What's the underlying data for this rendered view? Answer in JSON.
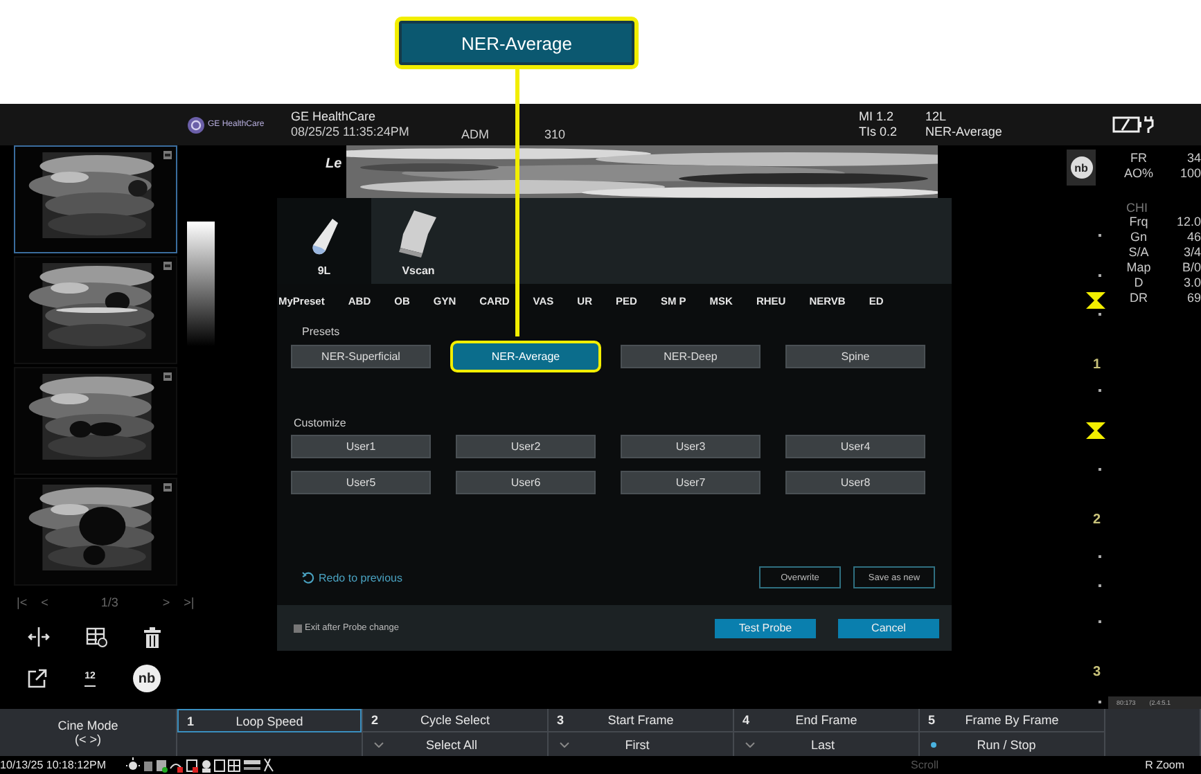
{
  "callout": {
    "label": "NER-Average"
  },
  "header": {
    "brand": "GE HealthCare",
    "title": "GE HealthCare",
    "datetime": "08/25/25 11:35:24PM",
    "operator": "ADM",
    "field_3": "310",
    "mi": "MI 1.2",
    "tis": "TIs 0.2",
    "probe": "12L",
    "preset": "NER-Average"
  },
  "thumbnails": [
    {
      "selected": true
    },
    {
      "selected": false
    },
    {
      "selected": false
    },
    {
      "selected": false
    }
  ],
  "pager": {
    "first": "|<",
    "prev": "<",
    "page": "1/3",
    "next": ">",
    "last": ">|"
  },
  "left_tools": {
    "count": "12",
    "nb": "nb"
  },
  "image": {
    "label": "Le"
  },
  "dialog": {
    "probes": [
      {
        "name": "9L",
        "selected": true
      },
      {
        "name": "Vscan",
        "selected": false
      }
    ],
    "categories": [
      "MyPreset",
      "ABD",
      "OB",
      "GYN",
      "CARD",
      "VAS",
      "UR",
      "PED",
      "SM P",
      "MSK",
      "RHEU",
      "NERVB",
      "ED"
    ],
    "presets_label": "Presets",
    "presets": [
      {
        "label": "NER-Superficial",
        "selected": false
      },
      {
        "label": "NER-Average",
        "selected": true
      },
      {
        "label": "NER-Deep",
        "selected": false
      },
      {
        "label": "Spine",
        "selected": false
      }
    ],
    "customize_label": "Customize",
    "user_presets": [
      "User1",
      "User2",
      "User3",
      "User4",
      "User5",
      "User6",
      "User7",
      "User8"
    ],
    "redo": "Redo to previous",
    "overwrite": "Overwrite",
    "save_as_new": "Save as new",
    "exit_after_probe_change": {
      "label": "Exit after Probe change",
      "checked": false
    },
    "test_probe": "Test Probe",
    "cancel": "Cancel"
  },
  "params": {
    "nb": "nb",
    "top": [
      {
        "name": "FR",
        "value": "34"
      },
      {
        "name": "AO%",
        "value": "100"
      }
    ],
    "mode": "CHI",
    "rows": [
      {
        "name": "Frq",
        "value": "12.0"
      },
      {
        "name": "Gn",
        "value": "46"
      },
      {
        "name": "S/A",
        "value": "3/4"
      },
      {
        "name": "Map",
        "value": "B/0"
      },
      {
        "name": "D",
        "value": "3.0"
      },
      {
        "name": "DR",
        "value": "69"
      }
    ]
  },
  "depth_scale": [
    "1",
    "2",
    "3"
  ],
  "readout": [
    "80:173",
    "(2.4:5.1"
  ],
  "bottom_bar": {
    "mode": {
      "title": "Cine Mode",
      "hint": "(< >)"
    },
    "controls": [
      {
        "number": "1",
        "label": "Loop Speed",
        "kind": "none",
        "selected": true
      },
      {
        "number": "2",
        "label": "Cycle Select",
        "value": "Select All",
        "kind": "dropdown",
        "selected": false
      },
      {
        "number": "3",
        "label": "Start Frame",
        "value": "First",
        "kind": "dropdown",
        "selected": false
      },
      {
        "number": "4",
        "label": "End Frame",
        "value": "Last",
        "kind": "dropdown",
        "selected": false
      },
      {
        "number": "5",
        "label": "Frame By Frame",
        "value": "Run / Stop",
        "kind": "dot",
        "selected": false
      }
    ]
  },
  "status_bar": {
    "datetime": "10/13/25 10:18:12PM",
    "center": "Scroll",
    "right": "R Zoom"
  }
}
